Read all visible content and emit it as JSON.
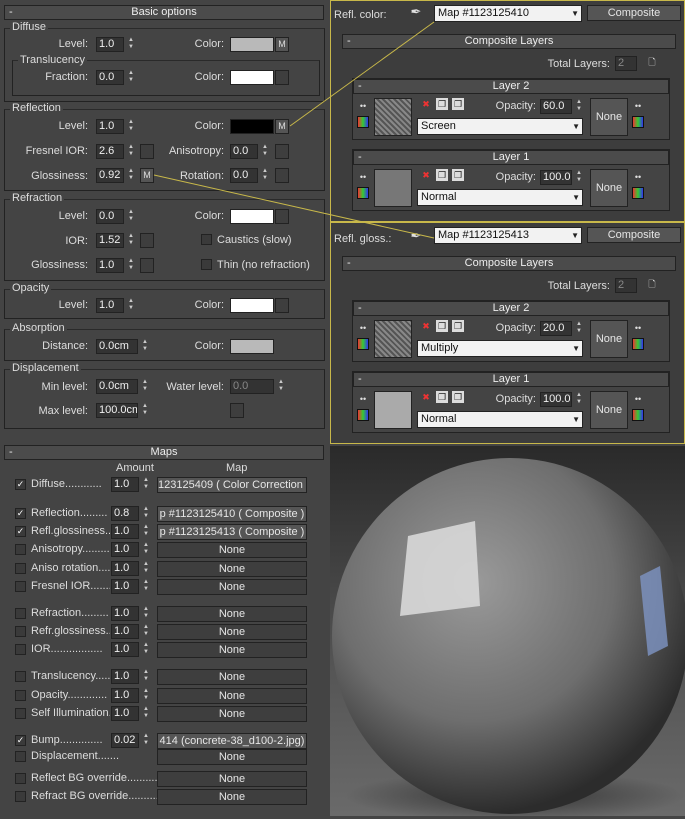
{
  "basic": {
    "rollout_title": "Basic options",
    "diffuse": {
      "group": "Diffuse",
      "level_label": "Level:",
      "level": "1.0",
      "color_label": "Color:",
      "map_btn": "M",
      "color": "#b9b9b9"
    },
    "translucency": {
      "group": "Translucency",
      "fraction_label": "Fraction:",
      "fraction": "0.0",
      "color_label": "Color:",
      "color": "#ffffff"
    },
    "reflection": {
      "group": "Reflection",
      "level_label": "Level:",
      "level": "1.0",
      "color_label": "Color:",
      "color": "#000000",
      "map_btn": "M",
      "fresnel_label": "Fresnel IOR:",
      "fresnel": "2.6",
      "aniso_label": "Anisotropy:",
      "aniso": "0.0",
      "gloss_label": "Glossiness:",
      "gloss": "0.92",
      "gloss_map_btn": "M",
      "rotation_label": "Rotation:",
      "rotation": "0.0"
    },
    "refraction": {
      "group": "Refraction",
      "level_label": "Level:",
      "level": "0.0",
      "color_label": "Color:",
      "color": "#ffffff",
      "ior_label": "IOR:",
      "ior": "1.52",
      "caustics_label": "Caustics (slow)",
      "gloss_label": "Glossiness:",
      "gloss": "1.0",
      "thin_label": "Thin (no refraction)"
    },
    "opacity": {
      "group": "Opacity",
      "level_label": "Level:",
      "level": "1.0",
      "color_label": "Color:",
      "color": "#ffffff"
    },
    "absorption": {
      "group": "Absorption",
      "distance_label": "Distance:",
      "distance": "0.0cm",
      "color_label": "Color:",
      "color": "#b9b9b9"
    },
    "displacement": {
      "group": "Displacement",
      "min_label": "Min level:",
      "min": "0.0cm",
      "water_label": "Water level:",
      "water": "0.0",
      "max_label": "Max level:",
      "max": "100.0cm"
    }
  },
  "maps": {
    "rollout_title": "Maps",
    "amount_header": "Amount",
    "map_header": "Map",
    "rows": [
      {
        "label": "Diffuse............",
        "checked": true,
        "amount": "1.0",
        "map": "123125409  ( Color Correction )"
      },
      {
        "label": "Reflection.........",
        "checked": true,
        "amount": "0.8",
        "map": "p #1123125410  ( Composite )"
      },
      {
        "label": "Refl.glossiness..",
        "checked": true,
        "amount": "1.0",
        "map": "p #1123125413  ( Composite )"
      },
      {
        "label": "Anisotropy.........",
        "checked": false,
        "amount": "1.0",
        "map": "None"
      },
      {
        "label": "Aniso rotation....",
        "checked": false,
        "amount": "1.0",
        "map": "None"
      },
      {
        "label": "Fresnel IOR.......",
        "checked": false,
        "amount": "1.0",
        "map": "None"
      },
      {
        "label": "Refraction.........",
        "checked": false,
        "amount": "1.0",
        "map": "None"
      },
      {
        "label": "Refr.glossiness..",
        "checked": false,
        "amount": "1.0",
        "map": "None"
      },
      {
        "label": "IOR.................",
        "checked": false,
        "amount": "1.0",
        "map": "None"
      },
      {
        "label": "Translucency......",
        "checked": false,
        "amount": "1.0",
        "map": "None"
      },
      {
        "label": "Opacity.............",
        "checked": false,
        "amount": "1.0",
        "map": "None"
      },
      {
        "label": "Self Illumination.",
        "checked": false,
        "amount": "1.0",
        "map": "None"
      },
      {
        "label": "Bump..............",
        "checked": true,
        "amount": "0.02",
        "map": "414 (concrete-38_d100-2.jpg)"
      },
      {
        "label": "Displacement.......",
        "checked": false,
        "amount": "",
        "map": "None"
      },
      {
        "label": "Reflect BG override..........",
        "checked": false,
        "amount": "",
        "map": "None"
      },
      {
        "label": "Refract BG override..........",
        "checked": false,
        "amount": "",
        "map": "None"
      }
    ]
  },
  "refl_color": {
    "label": "Refl. color:",
    "map_name": "Map #1123125410",
    "type_btn": "Composite",
    "rollout_title": "Composite Layers",
    "total_label": "Total Layers:",
    "total": "2",
    "layers": [
      {
        "title": "Layer 2",
        "opacity_label": "Opacity:",
        "opacity": "60.0",
        "blend": "Screen",
        "none_btn": "None"
      },
      {
        "title": "Layer 1",
        "opacity_label": "Opacity:",
        "opacity": "100.0",
        "blend": "Normal",
        "none_btn": "None"
      }
    ]
  },
  "refl_gloss": {
    "label": "Refl. gloss.:",
    "map_name": "Map #1123125413",
    "type_btn": "Composite",
    "rollout_title": "Composite Layers",
    "total_label": "Total Layers:",
    "total": "2",
    "layers": [
      {
        "title": "Layer 2",
        "opacity_label": "Opacity:",
        "opacity": "20.0",
        "blend": "Multiply",
        "none_btn": "None"
      },
      {
        "title": "Layer 1",
        "opacity_label": "Opacity:",
        "opacity": "100.0",
        "blend": "Normal",
        "none_btn": "None"
      }
    ]
  },
  "colors": {
    "link_line": "#c8b84a"
  }
}
